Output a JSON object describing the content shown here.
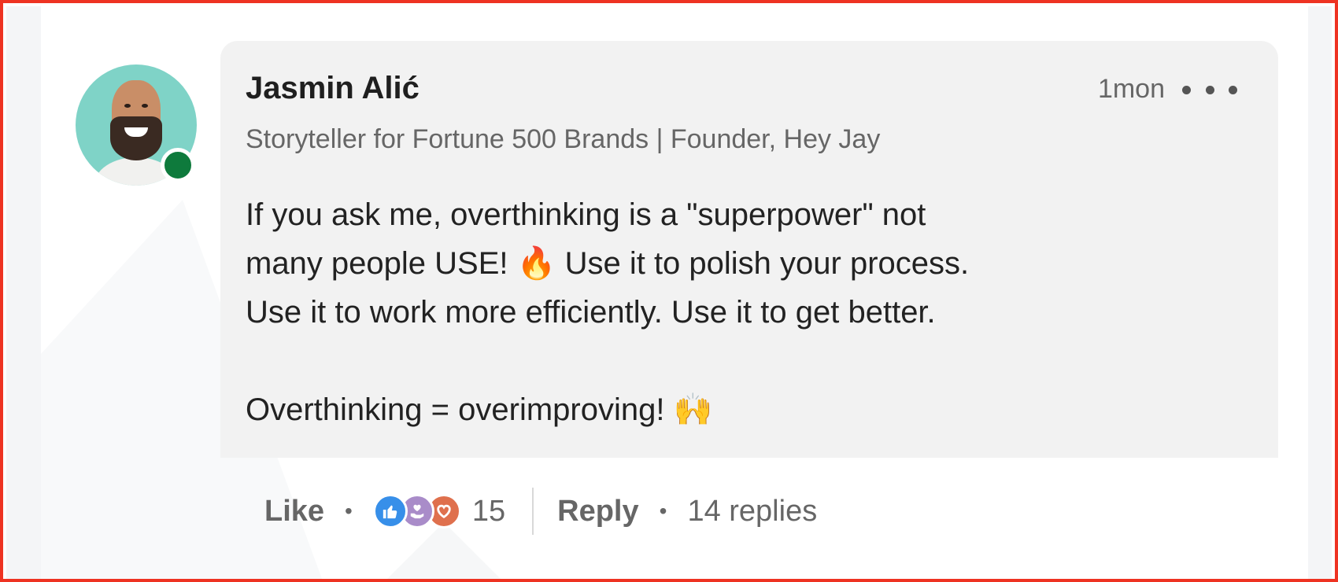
{
  "comment": {
    "author": "Jasmin Alić",
    "timestamp": "1mon",
    "headline": "Storyteller for Fortune 500 Brands | Founder, Hey Jay",
    "body": {
      "line1": "If you ask me, overthinking is a \"superpower\" not",
      "line2_before_emoji": "many people USE!",
      "line2_emoji": "🔥",
      "line2_after_emoji": "Use it to polish your process.",
      "line3": "Use it to work more efficiently. Use it to get better.",
      "line4_text": "Overthinking = overimproving!",
      "line4_emoji": "🙌"
    },
    "online_status": "online",
    "status_color": "#0e7a3c"
  },
  "actions": {
    "like_label": "Like",
    "reaction_count": "15",
    "reactions": [
      "like-icon",
      "support-icon",
      "love-icon"
    ],
    "reply_label": "Reply",
    "replies_label": "14 replies"
  },
  "theme": {
    "frame_border": "#ee3322",
    "bubble_bg": "#f2f2f2",
    "like_color": "#378fe9",
    "love_color": "#df704d",
    "support_color": "#a98cc9"
  }
}
